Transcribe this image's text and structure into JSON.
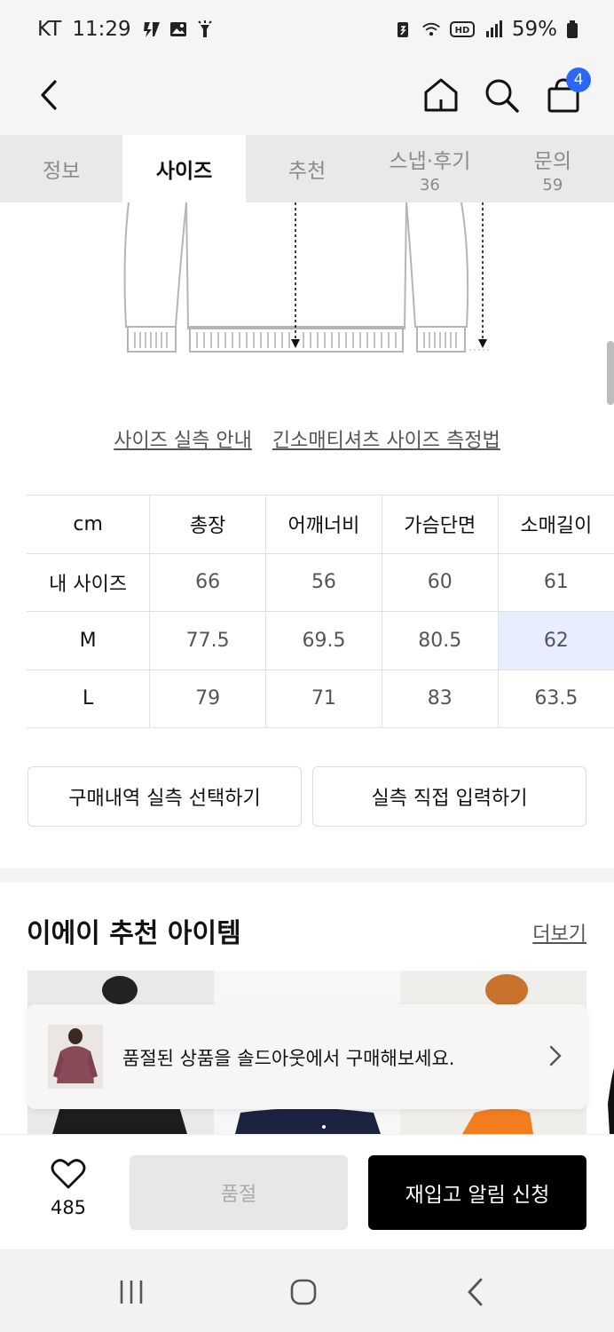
{
  "status_bar": {
    "carrier": "KT",
    "time": "11:29",
    "battery": "59%"
  },
  "header": {
    "cart_count": "4"
  },
  "tabs": [
    {
      "label": "정보",
      "count": ""
    },
    {
      "label": "사이즈",
      "count": ""
    },
    {
      "label": "추천",
      "count": ""
    },
    {
      "label": "스냅·후기",
      "count": "36"
    },
    {
      "label": "문의",
      "count": "59"
    }
  ],
  "size_links": {
    "guide": "사이즈 실측 안내",
    "method": "긴소매티셔츠 사이즈 측정법"
  },
  "size_table": {
    "headers": [
      "cm",
      "총장",
      "어깨너비",
      "가슴단면",
      "소매길이"
    ],
    "rows": [
      {
        "label": "내 사이즈",
        "values": [
          "66",
          "56",
          "60",
          "61"
        ]
      },
      {
        "label": "M",
        "values": [
          "77.5",
          "69.5",
          "80.5",
          "62"
        ]
      },
      {
        "label": "L",
        "values": [
          "79",
          "71",
          "83",
          "63.5"
        ]
      }
    ]
  },
  "actions": {
    "select_history": "구매내역 실측 선택하기",
    "manual_input": "실측 직접 입력하기"
  },
  "recommend": {
    "title": "이에이 추천 아이템",
    "more": "더보기"
  },
  "toast": {
    "message": "품절된 상품을 솔드아웃에서 구매해보세요."
  },
  "bottom_bar": {
    "like_count": "485",
    "soldout_label": "품절",
    "restock_label": "재입고 알림 신청"
  },
  "colors": {
    "accent_blue": "#2b66f6",
    "highlight_cell": "#e8eeff",
    "primary_button": "#000000"
  }
}
